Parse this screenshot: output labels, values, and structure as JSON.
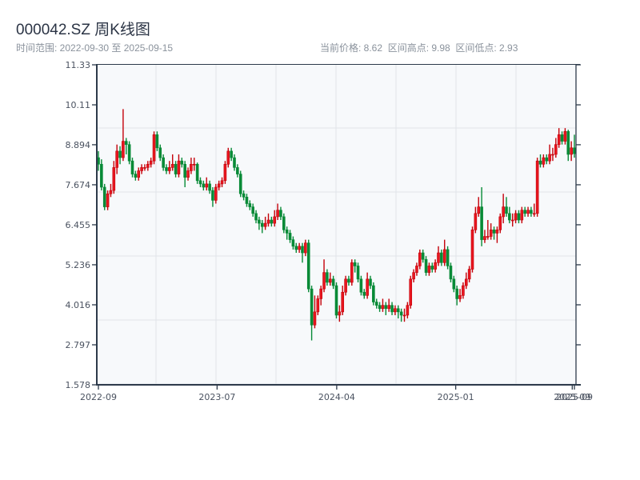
{
  "header": {
    "title": "000042.SZ 周K线图",
    "range_text": "时间范围: 2022-09-30 至 2025-09-15",
    "stats_text": "当前价格: 8.62  区间高点: 9.98  区间低点: 2.93"
  },
  "colors": {
    "up": "#e8161f",
    "up_border": "#c40009",
    "down": "#078a36",
    "plot_bg": "#f7f9fb",
    "grid": "#e1e4e8",
    "axis": "#2d3a4a"
  },
  "chart_data": {
    "type": "candlestick",
    "title": "000042.SZ 周K线图",
    "frequency": "weekly",
    "date_range": [
      "2022-09-30",
      "2025-09-15"
    ],
    "current_price": 8.62,
    "range_high": 9.98,
    "range_low": 2.93,
    "ylim": [
      1.578,
      11.33
    ],
    "y_ticks": [
      "11.33",
      "10.11",
      "8.894",
      "7.674",
      "6.455",
      "5.236",
      "4.016",
      "2.797",
      "1.578"
    ],
    "x_ticks": [
      {
        "label": "2022-09",
        "index": 0
      },
      {
        "label": "2023-07",
        "index": 38.4
      },
      {
        "label": "2024-04",
        "index": 77.1
      },
      {
        "label": "2025-01",
        "index": 115.6
      },
      {
        "label": "2025-09",
        "index": 153.3
      },
      {
        "label": "2025-09",
        "index": 154
      }
    ],
    "up_color_meaning": "red = rise, green = fall",
    "grid": true,
    "ohlc_columns": [
      "open",
      "high",
      "low",
      "close"
    ],
    "ohlc": [
      [
        8.5,
        8.7,
        8.1,
        8.3
      ],
      [
        8.3,
        8.45,
        7.5,
        7.6
      ],
      [
        7.6,
        7.7,
        6.9,
        7.0
      ],
      [
        7.0,
        7.5,
        6.9,
        7.4
      ],
      [
        7.4,
        7.7,
        7.3,
        7.5
      ],
      [
        7.5,
        8.4,
        7.4,
        8.2
      ],
      [
        8.2,
        8.9,
        8.0,
        8.7
      ],
      [
        8.7,
        8.85,
        8.3,
        8.5
      ],
      [
        8.5,
        9.98,
        8.4,
        9.0
      ],
      [
        9.0,
        9.1,
        8.6,
        8.9
      ],
      [
        8.9,
        9.0,
        8.3,
        8.4
      ],
      [
        8.4,
        8.5,
        7.9,
        8.0
      ],
      [
        8.0,
        8.1,
        7.8,
        7.9
      ],
      [
        7.9,
        8.2,
        7.8,
        8.1
      ],
      [
        8.1,
        8.3,
        8.0,
        8.2
      ],
      [
        8.2,
        8.3,
        8.1,
        8.2
      ],
      [
        8.2,
        8.4,
        8.1,
        8.3
      ],
      [
        8.3,
        8.5,
        8.2,
        8.4
      ],
      [
        8.4,
        9.3,
        8.3,
        9.2
      ],
      [
        9.2,
        9.3,
        8.7,
        8.8
      ],
      [
        8.8,
        8.9,
        8.4,
        8.5
      ],
      [
        8.5,
        8.6,
        8.1,
        8.2
      ],
      [
        8.2,
        8.3,
        8.0,
        8.1
      ],
      [
        8.1,
        8.4,
        8.0,
        8.2
      ],
      [
        8.2,
        8.6,
        8.1,
        8.3
      ],
      [
        8.3,
        8.4,
        7.9,
        8.0
      ],
      [
        8.0,
        8.6,
        7.9,
        8.4
      ],
      [
        8.4,
        8.5,
        8.2,
        8.3
      ],
      [
        8.3,
        8.4,
        7.6,
        7.9
      ],
      [
        7.9,
        8.2,
        7.8,
        8.1
      ],
      [
        8.1,
        8.5,
        8.0,
        8.3
      ],
      [
        8.3,
        8.5,
        8.1,
        8.3
      ],
      [
        8.3,
        8.35,
        7.7,
        7.8
      ],
      [
        7.8,
        7.9,
        7.6,
        7.7
      ],
      [
        7.7,
        7.8,
        7.5,
        7.6
      ],
      [
        7.6,
        7.9,
        7.5,
        7.7
      ],
      [
        7.7,
        7.8,
        7.4,
        7.5
      ],
      [
        7.5,
        7.6,
        7.0,
        7.2
      ],
      [
        7.2,
        7.7,
        7.1,
        7.6
      ],
      [
        7.6,
        7.8,
        7.5,
        7.7
      ],
      [
        7.7,
        7.9,
        7.6,
        7.8
      ],
      [
        7.8,
        8.4,
        7.7,
        8.3
      ],
      [
        8.3,
        8.8,
        8.2,
        8.7
      ],
      [
        8.7,
        8.8,
        8.4,
        8.5
      ],
      [
        8.5,
        8.6,
        8.1,
        8.2
      ],
      [
        8.2,
        8.3,
        7.9,
        8.0
      ],
      [
        8.0,
        8.1,
        7.3,
        7.4
      ],
      [
        7.4,
        7.5,
        7.2,
        7.3
      ],
      [
        7.3,
        7.4,
        7.0,
        7.1
      ],
      [
        7.1,
        7.2,
        6.9,
        7.0
      ],
      [
        7.0,
        7.1,
        6.7,
        6.8
      ],
      [
        6.8,
        6.9,
        6.5,
        6.6
      ],
      [
        6.6,
        6.7,
        6.3,
        6.5
      ],
      [
        6.5,
        6.6,
        6.2,
        6.4
      ],
      [
        6.4,
        6.7,
        6.3,
        6.5
      ],
      [
        6.5,
        6.8,
        6.4,
        6.6
      ],
      [
        6.6,
        6.7,
        6.4,
        6.5
      ],
      [
        6.5,
        6.9,
        6.4,
        6.7
      ],
      [
        6.7,
        7.1,
        6.6,
        6.9
      ],
      [
        6.9,
        7.0,
        6.6,
        6.7
      ],
      [
        6.7,
        6.8,
        6.2,
        6.3
      ],
      [
        6.3,
        6.4,
        6.0,
        6.2
      ],
      [
        6.2,
        6.3,
        5.9,
        6.0
      ],
      [
        6.0,
        6.1,
        5.7,
        5.8
      ],
      [
        5.8,
        5.9,
        5.6,
        5.7
      ],
      [
        5.7,
        5.9,
        5.6,
        5.8
      ],
      [
        5.8,
        5.9,
        5.3,
        5.6
      ],
      [
        5.6,
        6.0,
        5.5,
        5.9
      ],
      [
        5.9,
        6.0,
        4.4,
        4.5
      ],
      [
        4.5,
        4.6,
        2.93,
        3.4
      ],
      [
        3.4,
        4.3,
        3.3,
        3.8
      ],
      [
        3.8,
        4.3,
        3.7,
        4.2
      ],
      [
        4.2,
        4.6,
        4.0,
        4.5
      ],
      [
        4.5,
        5.4,
        4.4,
        5.0
      ],
      [
        5.0,
        5.1,
        4.6,
        4.7
      ],
      [
        4.7,
        5.0,
        4.6,
        4.8
      ],
      [
        4.8,
        4.9,
        4.5,
        4.6
      ],
      [
        4.6,
        4.7,
        3.6,
        3.7
      ],
      [
        3.7,
        4.0,
        3.5,
        3.8
      ],
      [
        3.8,
        4.6,
        3.7,
        4.4
      ],
      [
        4.4,
        4.9,
        4.3,
        4.8
      ],
      [
        4.8,
        4.9,
        4.6,
        4.7
      ],
      [
        4.7,
        5.4,
        4.6,
        5.3
      ],
      [
        5.3,
        5.4,
        5.0,
        5.2
      ],
      [
        5.2,
        5.3,
        4.7,
        4.8
      ],
      [
        4.8,
        4.9,
        4.3,
        4.4
      ],
      [
        4.4,
        4.5,
        4.2,
        4.3
      ],
      [
        4.3,
        5.0,
        4.2,
        4.8
      ],
      [
        4.8,
        4.9,
        4.5,
        4.6
      ],
      [
        4.6,
        4.7,
        4.0,
        4.1
      ],
      [
        4.1,
        4.2,
        3.9,
        4.0
      ],
      [
        4.0,
        4.1,
        3.8,
        3.9
      ],
      [
        3.9,
        4.2,
        3.8,
        4.0
      ],
      [
        4.0,
        4.1,
        3.7,
        3.9
      ],
      [
        3.9,
        4.2,
        3.8,
        4.0
      ],
      [
        4.0,
        4.1,
        3.7,
        3.8
      ],
      [
        3.8,
        4.0,
        3.7,
        3.9
      ],
      [
        3.9,
        4.0,
        3.6,
        3.8
      ],
      [
        3.8,
        3.9,
        3.5,
        3.7
      ],
      [
        3.7,
        3.9,
        3.5,
        3.7
      ],
      [
        3.7,
        4.1,
        3.6,
        4.0
      ],
      [
        4.0,
        4.9,
        3.9,
        4.8
      ],
      [
        4.8,
        5.1,
        4.7,
        5.0
      ],
      [
        5.0,
        5.3,
        4.9,
        5.2
      ],
      [
        5.2,
        5.7,
        5.1,
        5.6
      ],
      [
        5.6,
        5.7,
        5.3,
        5.4
      ],
      [
        5.4,
        5.5,
        4.9,
        5.0
      ],
      [
        5.0,
        5.3,
        4.9,
        5.2
      ],
      [
        5.2,
        5.3,
        5.0,
        5.1
      ],
      [
        5.1,
        5.4,
        5.0,
        5.3
      ],
      [
        5.3,
        5.8,
        5.2,
        5.6
      ],
      [
        5.6,
        5.7,
        5.2,
        5.3
      ],
      [
        5.3,
        6.0,
        5.2,
        5.7
      ],
      [
        5.7,
        5.8,
        5.1,
        5.2
      ],
      [
        5.2,
        5.3,
        4.7,
        4.8
      ],
      [
        4.8,
        4.9,
        4.4,
        4.5
      ],
      [
        4.5,
        4.6,
        4.0,
        4.2
      ],
      [
        4.2,
        4.5,
        4.1,
        4.3
      ],
      [
        4.3,
        4.7,
        4.2,
        4.6
      ],
      [
        4.6,
        5.0,
        4.5,
        4.8
      ],
      [
        4.8,
        5.2,
        4.7,
        5.1
      ],
      [
        5.1,
        6.4,
        5.0,
        6.3
      ],
      [
        6.3,
        7.0,
        6.2,
        6.8
      ],
      [
        6.8,
        7.3,
        6.7,
        7.0
      ],
      [
        7.0,
        7.6,
        5.8,
        6.0
      ],
      [
        6.0,
        6.3,
        5.9,
        6.1
      ],
      [
        6.1,
        6.6,
        6.0,
        6.1
      ],
      [
        6.1,
        6.5,
        6.0,
        6.3
      ],
      [
        6.3,
        6.4,
        6.0,
        6.2
      ],
      [
        6.2,
        6.4,
        5.9,
        6.3
      ],
      [
        6.3,
        6.8,
        6.2,
        6.7
      ],
      [
        6.7,
        7.4,
        6.5,
        7.0
      ],
      [
        7.0,
        7.3,
        6.7,
        6.8
      ],
      [
        6.8,
        7.0,
        6.5,
        6.6
      ],
      [
        6.6,
        6.8,
        6.4,
        6.6
      ],
      [
        6.6,
        6.9,
        6.5,
        6.8
      ],
      [
        6.8,
        6.9,
        6.5,
        6.6
      ],
      [
        6.6,
        7.0,
        6.5,
        6.9
      ],
      [
        6.9,
        7.0,
        6.7,
        6.8
      ],
      [
        6.8,
        7.0,
        6.7,
        6.9
      ],
      [
        6.9,
        7.0,
        6.7,
        6.8
      ],
      [
        6.8,
        7.1,
        6.7,
        6.8
      ],
      [
        6.8,
        8.5,
        6.7,
        8.4
      ],
      [
        8.4,
        8.6,
        8.2,
        8.3
      ],
      [
        8.3,
        8.6,
        8.2,
        8.5
      ],
      [
        8.5,
        8.6,
        8.3,
        8.4
      ],
      [
        8.4,
        8.9,
        8.3,
        8.6
      ],
      [
        8.6,
        8.8,
        8.4,
        8.6
      ],
      [
        8.6,
        9.1,
        8.5,
        8.9
      ],
      [
        8.9,
        9.4,
        8.8,
        9.2
      ],
      [
        9.2,
        9.3,
        8.9,
        9.0
      ],
      [
        9.0,
        9.4,
        8.9,
        9.3
      ],
      [
        9.3,
        9.35,
        8.4,
        8.6
      ],
      [
        8.6,
        9.0,
        8.4,
        8.8
      ],
      [
        8.8,
        9.2,
        8.5,
        8.62
      ]
    ]
  }
}
